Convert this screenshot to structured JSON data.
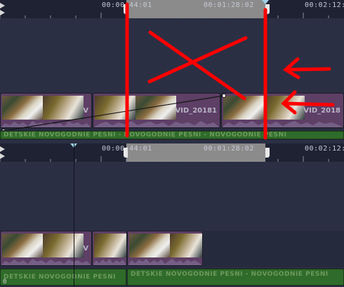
{
  "top_panel": {
    "ruler": {
      "labels": [
        "00:00:44:01",
        "00:01:28:02",
        "00:02:12:0"
      ]
    },
    "video_clips": [
      {
        "label": "V"
      },
      {
        "label": "VID_20181"
      },
      {
        "label": "VID_2018"
      }
    ],
    "audio_clip": {
      "label": "DETSKIE NOVOGODNIE PESNI - NOVOGODNIE PESNI - NOVOGODNIE PESNI"
    }
  },
  "bottom_panel": {
    "ruler": {
      "labels": [
        "00:00:44:01",
        "00:01:28:02",
        "00:02:12:0"
      ]
    },
    "video_clips": [
      {
        "label": "V"
      },
      {
        "label": ""
      },
      {
        "label": ""
      }
    ],
    "audio_clips": [
      {
        "label": "DETSKIE NOVOGODNIE PESNI"
      },
      {
        "label": "DETSKIE NOVOGODNIE PESNI - NOVOGODNIE PESNI"
      }
    ],
    "counter": "0"
  },
  "colors": {
    "background": "#2b2f44",
    "ruler_bg": "#1e2233",
    "zone": "#8b8b8b",
    "video_clip": "#5e3f66",
    "audio_clip": "#2f6b2a",
    "annotation": "#ff0000"
  },
  "icons": [
    "zone-in-bracket-icon",
    "zone-out-bracket-icon",
    "timeline-marker-icon",
    "track-expand-arrows-icon",
    "keyframe-dot-icon"
  ]
}
